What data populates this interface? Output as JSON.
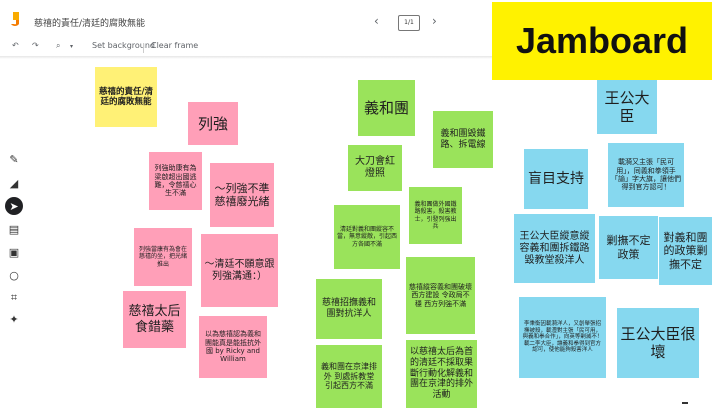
{
  "app": {
    "title": "慈禧的責任/清廷的腐敗無能",
    "frame_indicator": "1/1",
    "brand_label": "Jamboard",
    "accent_color": "#fff200"
  },
  "toolbar": {
    "undo_icon": "undo-icon",
    "redo_icon": "redo-icon",
    "zoom_icon": "zoom-icon",
    "set_background": "Set background",
    "clear_frame": "Clear frame"
  },
  "side_tools": [
    "pen-icon",
    "eraser-icon",
    "select-icon",
    "sticky-note-icon",
    "image-icon",
    "circle-icon",
    "text-box-icon",
    "laser-icon"
  ],
  "notes": [
    {
      "text": "慈禧的責任/清廷的腐敗無能",
      "color": "yellow"
    },
    {
      "text": "列強",
      "color": "pink"
    },
    {
      "text": "列強助康有為梁啟超出國逃難，令慈禧心生不滿",
      "color": "pink"
    },
    {
      "text": "～列強不準慈禧廢光緒",
      "color": "pink"
    },
    {
      "text": "列強當康有為會在慈禧的坐，把光緒推出",
      "color": "pink"
    },
    {
      "text": "～清廷不願意跟列強溝通：）",
      "color": "pink"
    },
    {
      "text": "慈禧太后食錯藥",
      "color": "pink"
    },
    {
      "text": "以為慈禧認為義和團能真是能抵抗外國 by Ricky and William",
      "color": "pink"
    },
    {
      "text": "義和團",
      "color": "green"
    },
    {
      "text": "義和團毀鐵路、拆電線",
      "color": "green"
    },
    {
      "text": "大刀會紅燈照",
      "color": "green"
    },
    {
      "text": "義和團做外國鐵路殺害，殺害教士，引發列強出兵",
      "color": "green"
    },
    {
      "text": "清廷對義和團縱容不當，無意縱敵，引起西方各國不滿",
      "color": "green"
    },
    {
      "text": "慈禧縱容義和團破壞西方建設 令政局不穩 西方列強不滿",
      "color": "green"
    },
    {
      "text": "慈禧招撫義和團對抗洋人",
      "color": "green"
    },
    {
      "text": "義和團在京津排外 到處拆教堂 引起西方不滿",
      "color": "green"
    },
    {
      "text": "以慈禧太后為首的清廷不採取果斷行動化解義和團在京津的排外活動",
      "color": "green"
    },
    {
      "text": "王公大臣",
      "color": "blue"
    },
    {
      "text": "盲目支持",
      "color": "blue"
    },
    {
      "text": "載漪又主張「民可用」，同義和拳領手「諭」字大旗，讓他們得到官方認可！",
      "color": "blue"
    },
    {
      "text": "王公大臣縱意縱容義和團拆鐵路毀教堂殺洋人",
      "color": "blue"
    },
    {
      "text": "剿撫不定政策",
      "color": "blue"
    },
    {
      "text": "對義和團的政策剿撫不定",
      "color": "blue"
    },
    {
      "text": "李秉衡因載漪洋人，又創舉張招撫被殺，載灃對主張「民可用，與義和拳合作」，向英等剿滅不！載二李大臣，讓義和拳得到官方認可，使他能夠殺害洋人",
      "color": "blue"
    },
    {
      "text": "王公大臣很壞",
      "color": "blue"
    }
  ]
}
